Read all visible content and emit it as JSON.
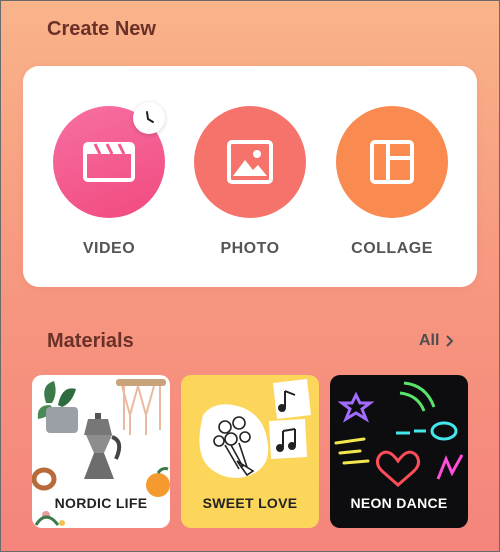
{
  "sections": {
    "create_title": "Create New",
    "materials_title": "Materials",
    "all_label": "All"
  },
  "create_buttons": [
    {
      "label": "VIDEO",
      "icon": "clapperboard-icon",
      "color": "#f35a8c"
    },
    {
      "label": "PHOTO",
      "icon": "image-icon",
      "color": "#f6736b"
    },
    {
      "label": "COLLAGE",
      "icon": "collage-layout-icon",
      "color": "#f98a50"
    }
  ],
  "materials": [
    {
      "label": "NORDIC LIFE"
    },
    {
      "label": "SWEET LOVE"
    },
    {
      "label": "NEON DANCE"
    }
  ],
  "colors": {
    "background_top": "#f9b48a",
    "background_bottom": "#f4847c",
    "title_text": "#6b3128"
  }
}
